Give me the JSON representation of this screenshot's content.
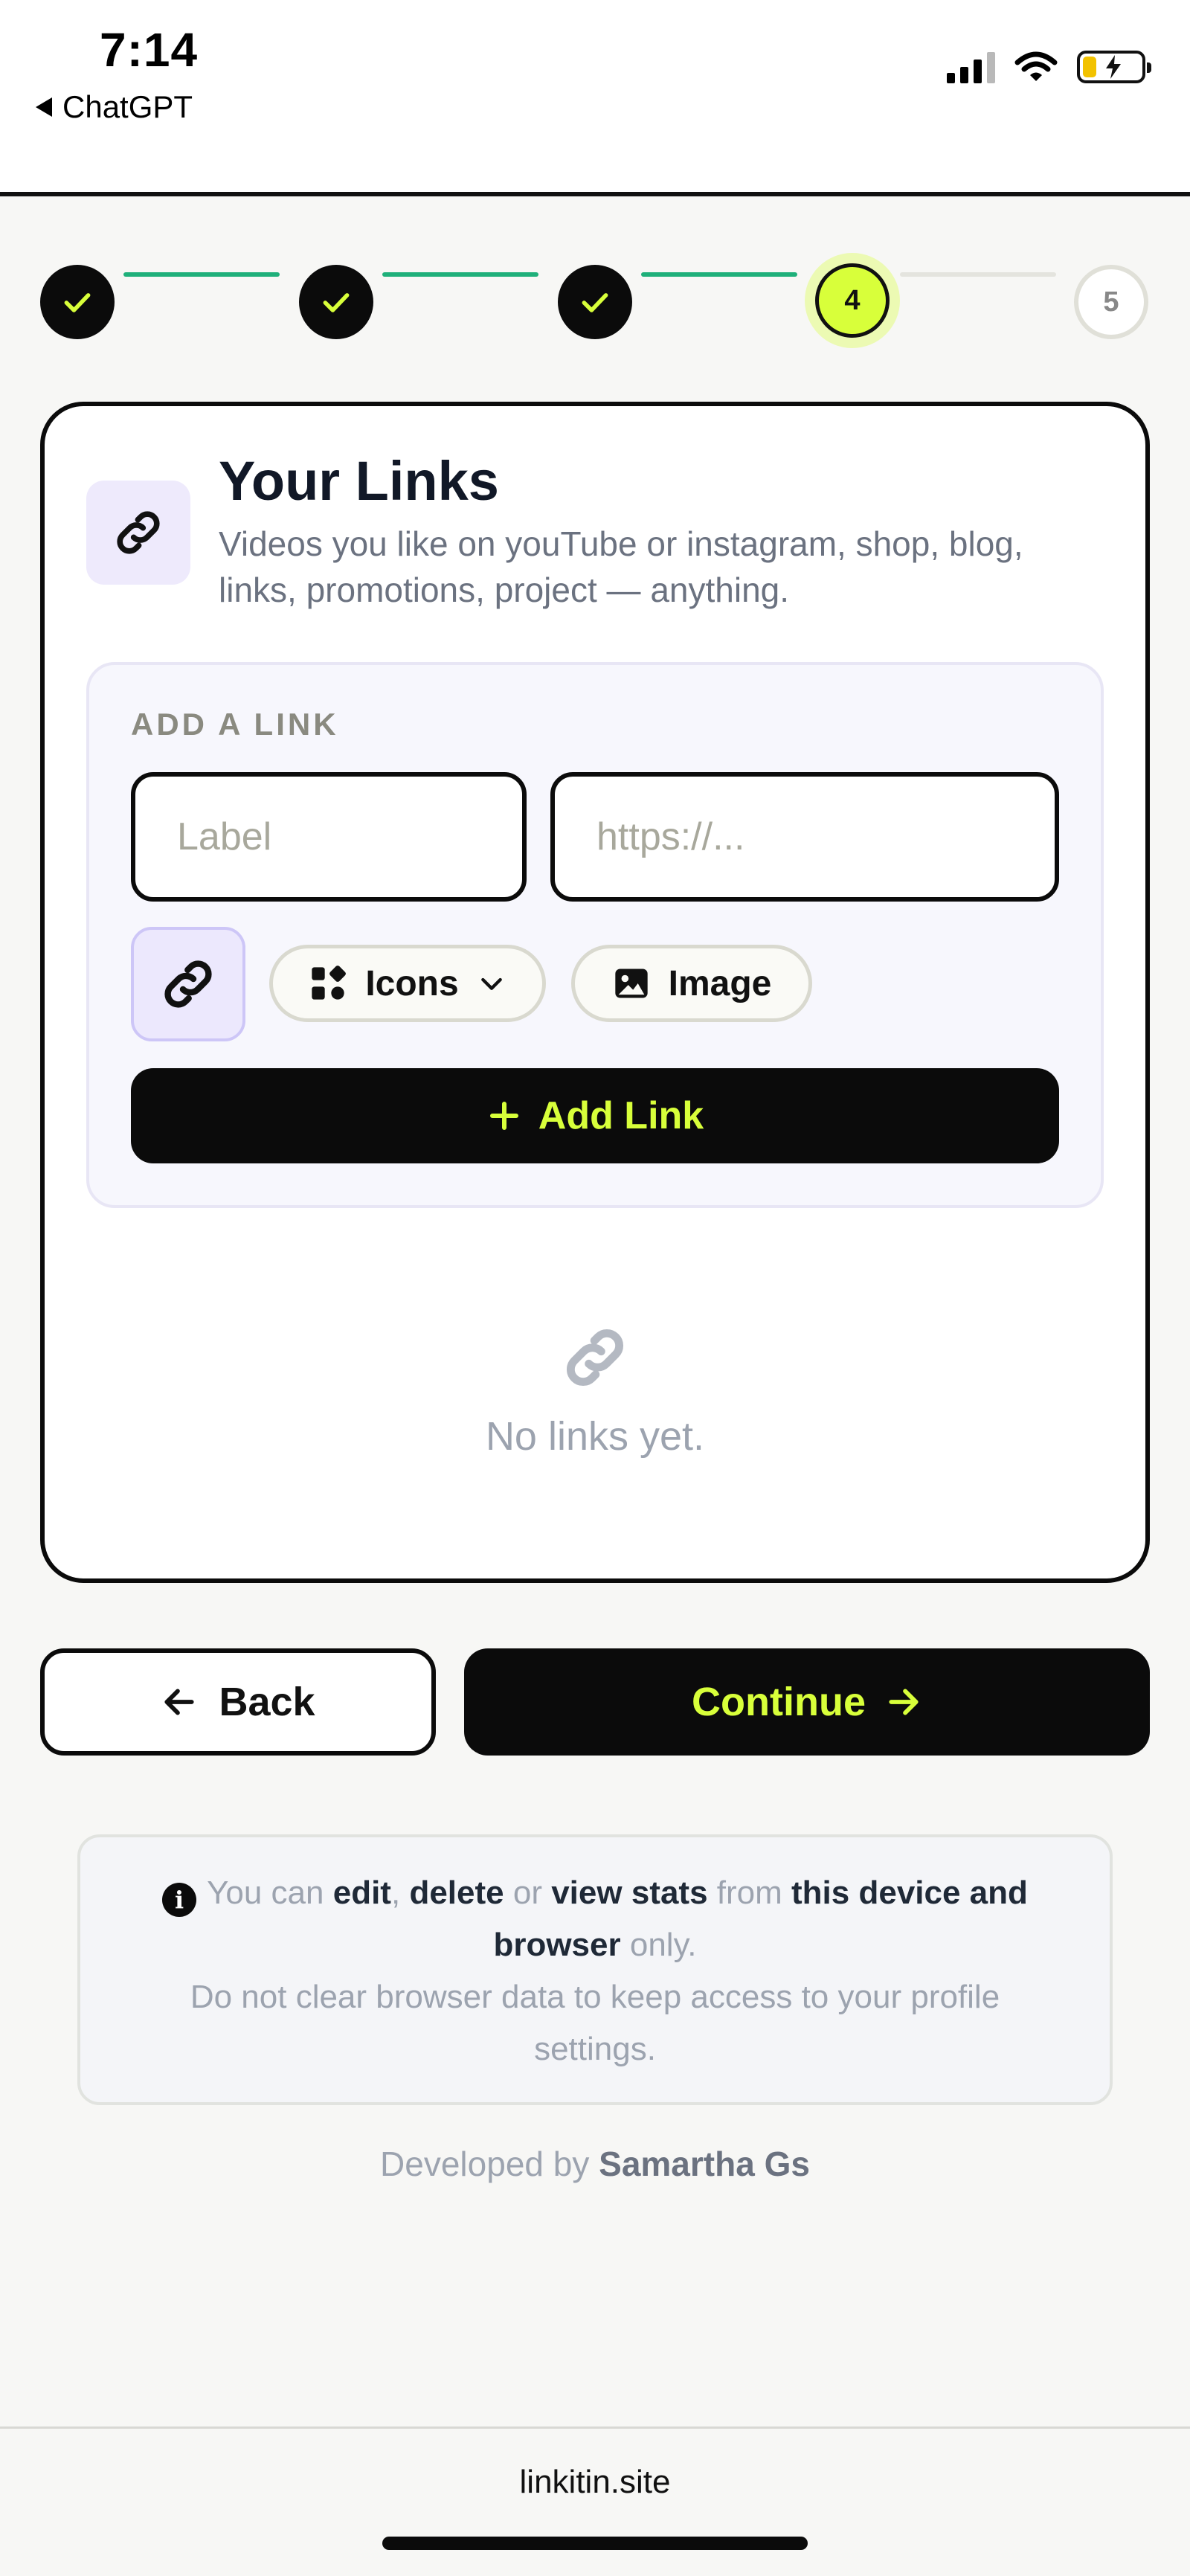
{
  "status_bar": {
    "time": "7:14",
    "back_app_label": "ChatGPT",
    "battery_color": "#f2c200"
  },
  "stepper": {
    "steps": [
      {
        "label": "",
        "state": "done"
      },
      {
        "label": "",
        "state": "done"
      },
      {
        "label": "",
        "state": "done"
      },
      {
        "label": "4",
        "state": "current"
      },
      {
        "label": "5",
        "state": "pending"
      }
    ],
    "accent": "#d8ff3a",
    "done_line_color": "#1fb07a"
  },
  "card": {
    "icon": "link-icon",
    "title": "Your Links",
    "description": "Videos you like on youTube or instagram, shop, blog, links, promotions, project — anything."
  },
  "add_link": {
    "heading": "ADD A LINK",
    "label_placeholder": "Label",
    "url_placeholder": "https://...",
    "icons_label": "Icons",
    "image_label": "Image",
    "add_button_label": "Add Link"
  },
  "empty_state": {
    "icon": "link-icon",
    "text": "No links yet."
  },
  "nav": {
    "back_label": "Back",
    "continue_label": "Continue"
  },
  "info": {
    "w1": "You can",
    "edit": "edit",
    "comma": ",",
    "delete": "delete",
    "or": "or",
    "view_stats": "view stats",
    "from": "from",
    "device": "this device and browser",
    "only": "only.",
    "line2": "Do not clear browser data to keep access to your profile settings."
  },
  "footer": {
    "developed_by": "Developed by",
    "developer": "Samartha Gs"
  },
  "browser": {
    "url": "linkitin.site"
  }
}
